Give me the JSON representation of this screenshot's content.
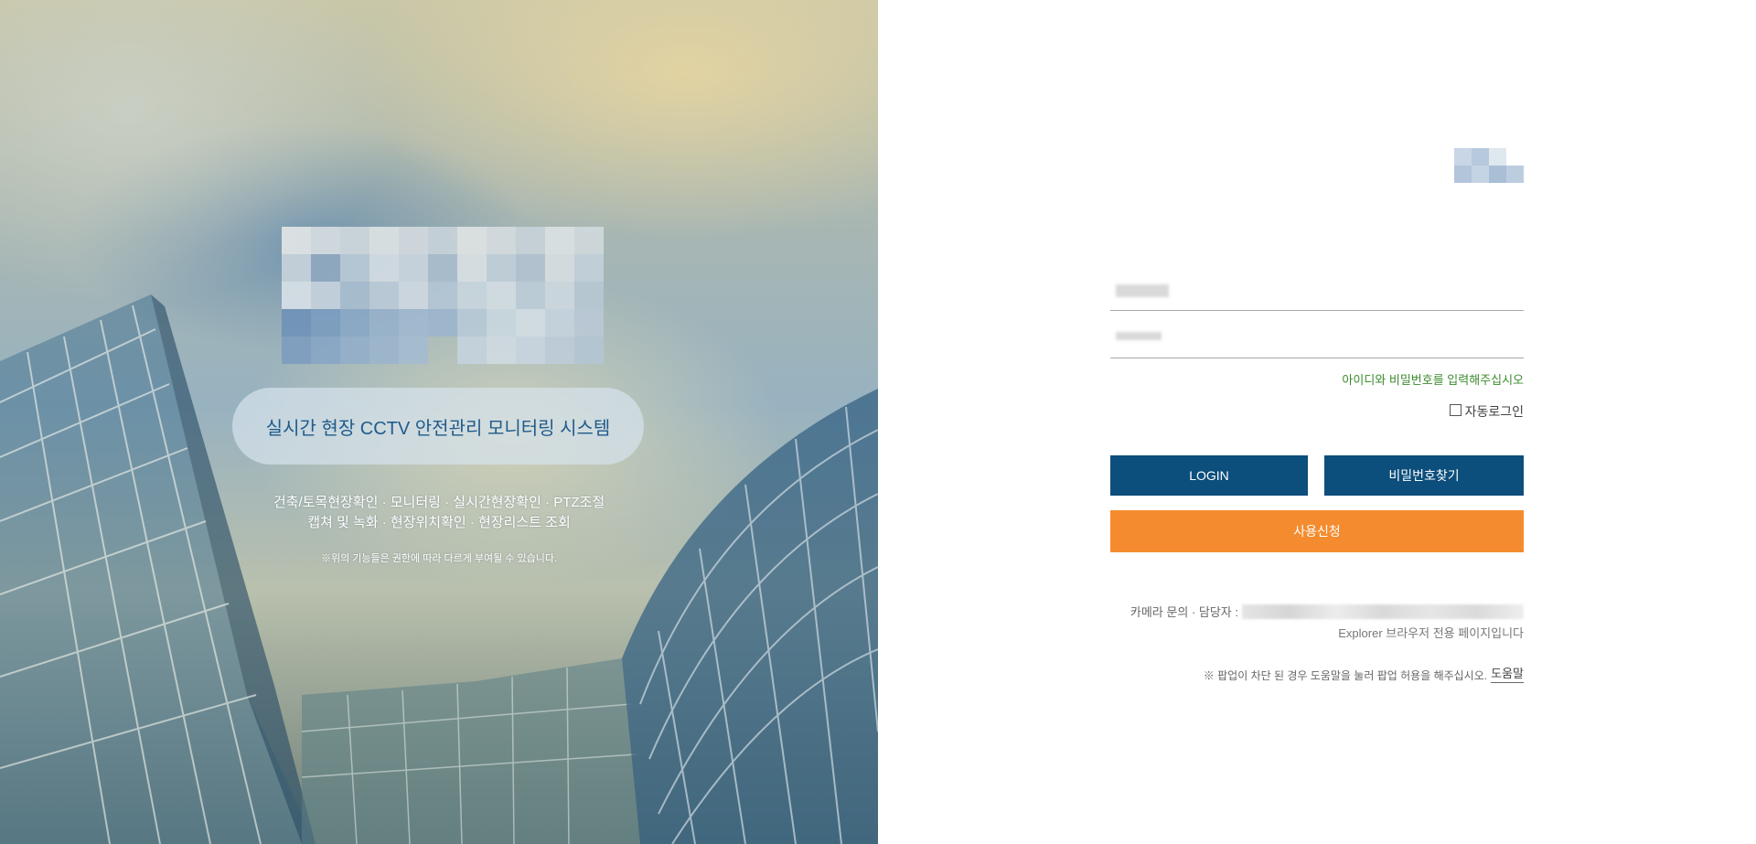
{
  "hero": {
    "system_title": "실시간 현장 CCTV 안전관리 모니터링 시스템",
    "features_line1": "건축/토목현장확인 · 모니터링 · 실시간현장확인 · PTZ조절",
    "features_line2": "캡쳐 및 녹화 · 현장위치확인 · 현장리스트 조회",
    "note": "※위의 기능들은 권한에 따라 다르게 부여될 수 있습니다."
  },
  "login": {
    "id_placeholder": "",
    "password_placeholder": "",
    "hint": "아이디와 비밀번호를 입력해주십시오",
    "auto_login_label": "자동로그인",
    "login_button": "LOGIN",
    "find_password_button": "비밀번호찾기",
    "signup_button": "사용신청"
  },
  "footer": {
    "contact_label": "카메라 문의 · 담당자 :",
    "browser_note": "Explorer 브라우저 전용 페이지입니다",
    "popup_note": "※ 팝업이 차단 된 경우 도움말을 눌러 팝업 허용을 해주십시오.",
    "help_link": "도움말"
  },
  "colors": {
    "primary": "#0c4e7c",
    "accent": "#f48c2f",
    "hint": "#3b8b2e",
    "title": "#1f5b8c"
  },
  "icons": {
    "logo_big": "pixelated-logo",
    "logo_small": "pixelated-logo"
  }
}
